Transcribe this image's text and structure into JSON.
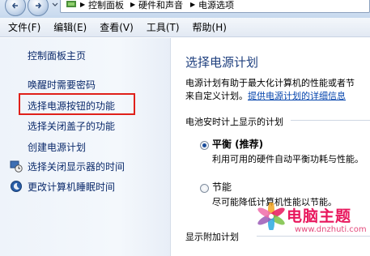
{
  "address_bar": {
    "crumbs": [
      "控制面板",
      "硬件和声音",
      "电源选项"
    ]
  },
  "menu": [
    "文件(F)",
    "编辑(E)",
    "查看(V)",
    "工具(T)",
    "帮助(H)"
  ],
  "left_pane": {
    "home": "控制面板主页",
    "links": {
      "wake_password": "唤醒时需要密码",
      "power_button": "选择电源按钮的功能",
      "lid": "选择关闭盖子的功能",
      "create_plan": "创建电源计划",
      "display_off": "选择关闭显示器的时间",
      "sleep_time": "更改计算机睡眠时间"
    }
  },
  "main": {
    "title": "选择电源计划",
    "description_line1": "电源计划有助于最大化计算机的性能或者节",
    "description_line2": "来自定义计划。",
    "description_link": "提供电源计划的详细信息",
    "battery_section": "电池安时计上显示的计划",
    "plans": [
      {
        "name": "平衡 (推荐)",
        "description": "利用可用的硬件自动平衡功耗与性能。",
        "selected": true
      },
      {
        "name": "节能",
        "description": "尽可能降低计算机性能以节能。",
        "selected": false
      }
    ],
    "show_more": "显示附加计划"
  },
  "watermark": {
    "name": "电脑主题",
    "url": "www.dnzhuti.com"
  },
  "colors": {
    "highlight_box": "#e0201a",
    "link": "#0b2a6b",
    "title": "#1e3f7e"
  }
}
